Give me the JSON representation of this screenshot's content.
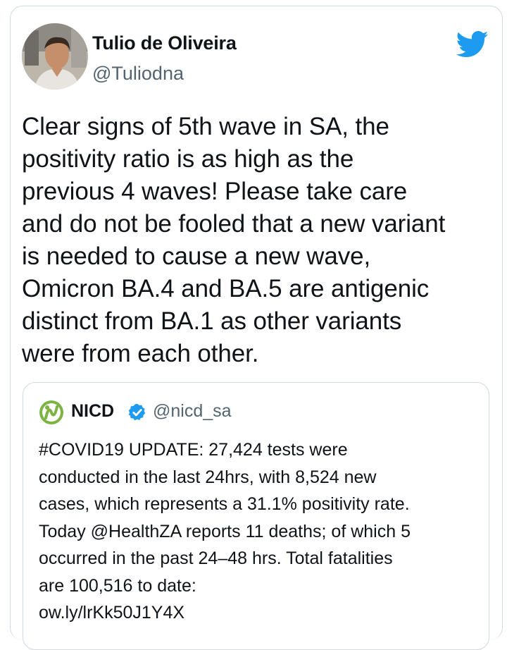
{
  "tweet": {
    "author_name": "Tulio de Oliveira",
    "author_handle": "@Tuliodna",
    "text": "Clear signs of 5th wave in SA, the\npositivity ratio is as high as the\nprevious 4 waves! Please take care\nand do not be fooled that a new variant\nis needed to cause a new wave,\nOmicron BA.4 and BA.5 are antigenic\ndistinct from BA.1 as other variants\nwere from each other."
  },
  "quoted_tweet": {
    "author_name": "NICD",
    "author_handle": "@nicd_sa",
    "verified": true,
    "text": "#COVID19 UPDATE: 27,424 tests were\nconducted in the last 24hrs, with 8,524 new\ncases, which represents a 31.1% positivity rate.\nToday @HealthZA reports 11 deaths; of which 5\noccurred in the past 24–48 hrs. Total fatalities\nare 100,516 to date:\now.ly/lrKk50J1Y4X"
  },
  "colors": {
    "twitter_blue": "#1d9bf0",
    "text_primary": "#0f1419",
    "text_secondary": "#536471",
    "border": "#cfd9de",
    "nicd_green": "#7cb342"
  },
  "icons": {
    "brand": "twitter-bird-icon",
    "verified": "verified-badge-icon",
    "quoted_avatar": "nicd-logo-icon"
  }
}
